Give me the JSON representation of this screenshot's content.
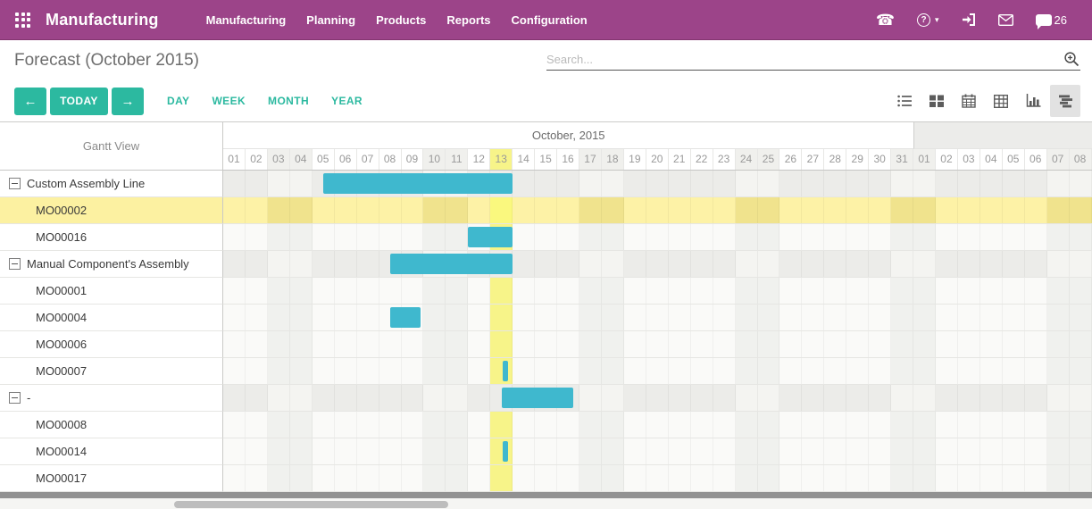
{
  "topbar": {
    "brand": "Manufacturing",
    "menu": [
      "Manufacturing",
      "Planning",
      "Products",
      "Reports",
      "Configuration"
    ],
    "message_count": "26",
    "icons": [
      "apps-grid",
      "phone",
      "help",
      "sign-in",
      "envelope",
      "chat"
    ]
  },
  "breadcrumb": {
    "title": "Forecast (October 2015)"
  },
  "search": {
    "placeholder": "Search..."
  },
  "controls": {
    "prev_label": "←",
    "today_label": "TODAY",
    "next_label": "→",
    "scales": [
      "DAY",
      "WEEK",
      "MONTH",
      "YEAR"
    ],
    "view_switcher": [
      "list",
      "kanban",
      "calendar",
      "pivot",
      "graph",
      "gantt"
    ],
    "active_view": "gantt"
  },
  "gantt": {
    "left_header": "Gantt View",
    "months": [
      {
        "label": "October, 2015",
        "count": 31,
        "shaded": false
      },
      {
        "label": "",
        "count": 8,
        "shaded": true
      }
    ],
    "day_labels": [
      "01",
      "02",
      "03",
      "04",
      "05",
      "06",
      "07",
      "08",
      "09",
      "10",
      "11",
      "12",
      "13",
      "14",
      "15",
      "16",
      "17",
      "18",
      "19",
      "20",
      "21",
      "22",
      "23",
      "24",
      "25",
      "26",
      "27",
      "28",
      "29",
      "30",
      "31",
      "01",
      "02",
      "03",
      "04",
      "05",
      "06",
      "07",
      "08"
    ],
    "weekend_indices": [
      2,
      3,
      9,
      10,
      16,
      17,
      23,
      24,
      30,
      31,
      37,
      38
    ],
    "today_index": 12,
    "rows": [
      {
        "label": "Custom Assembly Line",
        "type": "group",
        "highlight": false,
        "bars": [
          {
            "start": 4.5,
            "end": 13.0
          }
        ]
      },
      {
        "label": "MO00002",
        "type": "child",
        "highlight": true,
        "bars": []
      },
      {
        "label": "MO00016",
        "type": "child",
        "highlight": false,
        "bars": [
          {
            "start": 11.0,
            "end": 13.0
          }
        ]
      },
      {
        "label": "Manual Component's Assembly",
        "type": "group",
        "highlight": false,
        "bars": [
          {
            "start": 7.5,
            "end": 13.0
          }
        ]
      },
      {
        "label": "MO00001",
        "type": "child",
        "highlight": false,
        "bars": []
      },
      {
        "label": "MO00004",
        "type": "child",
        "highlight": false,
        "bars": [
          {
            "start": 7.5,
            "end": 8.85
          }
        ]
      },
      {
        "label": "MO00006",
        "type": "child",
        "highlight": false,
        "bars": []
      },
      {
        "label": "MO00007",
        "type": "child",
        "highlight": false,
        "bars": [
          {
            "start": 12.55,
            "end": 12.8
          }
        ]
      },
      {
        "label": "-",
        "type": "group",
        "highlight": false,
        "bars": [
          {
            "start": 12.5,
            "end": 15.7
          }
        ]
      },
      {
        "label": "MO00008",
        "type": "child",
        "highlight": false,
        "bars": []
      },
      {
        "label": "MO00014",
        "type": "child",
        "highlight": false,
        "bars": [
          {
            "start": 12.55,
            "end": 12.8
          }
        ]
      },
      {
        "label": "MO00017",
        "type": "child",
        "highlight": false,
        "bars": []
      }
    ],
    "colors": {
      "bar": "#3FB8CE",
      "today_column": "#F7F489",
      "highlight_row": "#FDF2A6",
      "weekend": "#F0F1EE",
      "navbar": "#9C4489",
      "accent_teal": "#2CB9A0"
    }
  }
}
